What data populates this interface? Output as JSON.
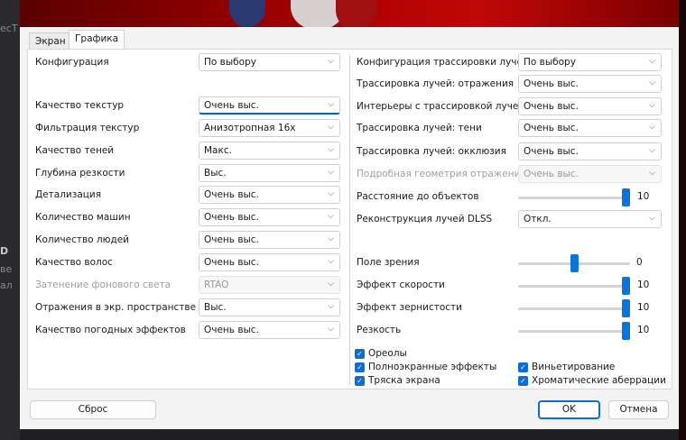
{
  "background": {
    "fragments": [
      "ecT",
      "D",
      "ве",
      "ал"
    ]
  },
  "tabs": [
    {
      "label": "Экран"
    },
    {
      "label": "Графика"
    }
  ],
  "left": [
    {
      "label": "Конфигурация",
      "value": "По выбору"
    },
    {
      "label": "Качество текстур",
      "value": "Очень выс."
    },
    {
      "label": "Фильтрация текстур",
      "value": "Анизотропная 16x"
    },
    {
      "label": "Качество теней",
      "value": "Макс."
    },
    {
      "label": "Глубина резкости",
      "value": "Выс."
    },
    {
      "label": "Детализация",
      "value": "Очень выс."
    },
    {
      "label": "Количество машин",
      "value": "Очень выс."
    },
    {
      "label": "Количество людей",
      "value": "Очень выс."
    },
    {
      "label": "Качество волос",
      "value": "Очень выс."
    },
    {
      "label": "Затенение фонового света",
      "value": "RTAO",
      "disabled": true
    },
    {
      "label": "Отражения в экр. пространстве",
      "value": "Выс."
    },
    {
      "label": "Качество погодных эффектов",
      "value": "Очень выс."
    }
  ],
  "right": [
    {
      "label": "Конфигурация трассировки лучей",
      "value": "По выбору"
    },
    {
      "label": "Трассировка лучей: отражения",
      "value": "Очень выс."
    },
    {
      "label": "Интерьеры с трассировкой лучей",
      "value": "Очень выс."
    },
    {
      "label": "Трассировка лучей: тени",
      "value": "Очень выс."
    },
    {
      "label": "Трассировка лучей: окклюзия",
      "value": "Очень выс."
    },
    {
      "label": "Подробная геометрия отражений",
      "value": "Очень выс.",
      "disabled": true
    },
    {
      "label": "Реконструкция лучей DLSS",
      "value": "Откл."
    }
  ],
  "sliders": [
    {
      "label": "Расстояние до объектов",
      "value": "10",
      "fraction": 1.0
    },
    {
      "label": "Поле зрения",
      "value": "0",
      "fraction": 0.5
    },
    {
      "label": "Эффект скорости",
      "value": "10",
      "fraction": 1.0
    },
    {
      "label": "Эффект зернистости",
      "value": "10",
      "fraction": 1.0
    },
    {
      "label": "Резкость",
      "value": "10",
      "fraction": 1.0
    }
  ],
  "checkboxes": [
    {
      "label": "Ореолы",
      "checked": true
    },
    {
      "label": "Полноэкранные эффекты",
      "checked": true
    },
    {
      "label": "Виньетирование",
      "checked": true
    },
    {
      "label": "Тряска экрана",
      "checked": true
    },
    {
      "label": "Хроматические аберрации",
      "checked": true
    }
  ],
  "buttons": {
    "reset": "Сброс",
    "ok": "OK",
    "cancel": "Отмена"
  },
  "accent": "#0a6fd0"
}
